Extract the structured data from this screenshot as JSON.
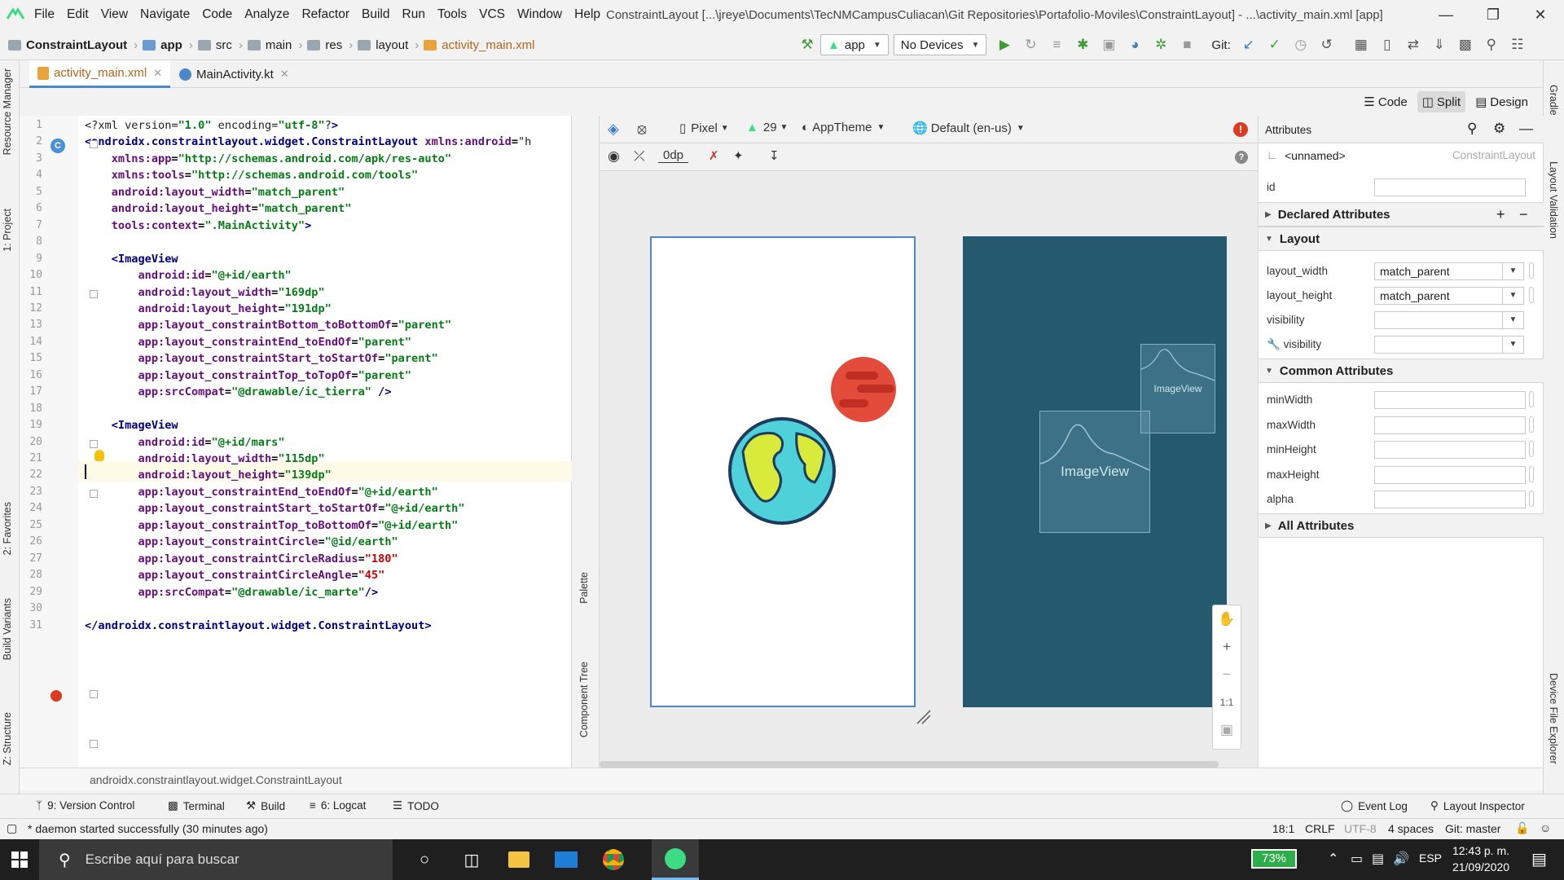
{
  "menubar": {
    "items": [
      "File",
      "Edit",
      "View",
      "Navigate",
      "Code",
      "Analyze",
      "Refactor",
      "Build",
      "Run",
      "Tools",
      "VCS",
      "Window",
      "Help"
    ],
    "title": "ConstraintLayout [...\\jreye\\Documents\\TecNMCampusCuliacan\\Git Repositories\\Portafolio-Moviles\\ConstraintLayout] - ...\\activity_main.xml [app]"
  },
  "breadcrumbs": [
    "ConstraintLayout",
    "app",
    "src",
    "main",
    "res",
    "layout",
    "activity_main.xml"
  ],
  "toolbar": {
    "run_config": "app",
    "device": "No Devices",
    "git_label": "Git:"
  },
  "tabs": [
    {
      "label": "activity_main.xml",
      "active": true
    },
    {
      "label": "MainActivity.kt",
      "active": false
    }
  ],
  "modes": {
    "code": "Code",
    "split": "Split",
    "design": "Design"
  },
  "code_lines": [
    "<?xml version=\"1.0\" encoding=\"utf-8\"?>",
    "<androidx.constraintlayout.widget.ConstraintLayout xmlns:android=\"h",
    "    xmlns:app=\"http://schemas.android.com/apk/res-auto\"",
    "    xmlns:tools=\"http://schemas.android.com/tools\"",
    "    android:layout_width=\"match_parent\"",
    "    android:layout_height=\"match_parent\"",
    "    tools:context=\".MainActivity\">",
    "",
    "    <ImageView",
    "        android:id=\"@+id/earth\"",
    "        android:layout_width=\"169dp\"",
    "        android:layout_height=\"191dp\"",
    "        app:layout_constraintBottom_toBottomOf=\"parent\"",
    "        app:layout_constraintEnd_toEndOf=\"parent\"",
    "        app:layout_constraintStart_toStartOf=\"parent\"",
    "        app:layout_constraintTop_toTopOf=\"parent\"",
    "        app:srcCompat=\"@drawable/ic_tierra\" />",
    "",
    "    <ImageView",
    "        android:id=\"@+id/mars\"",
    "        android:layout_width=\"115dp\"",
    "        android:layout_height=\"139dp\"",
    "        app:layout_constraintEnd_toEndOf=\"@+id/earth\"",
    "        app:layout_constraintStart_toStartOf=\"@+id/earth\"",
    "        app:layout_constraintTop_toBottomOf=\"@+id/earth\"",
    "        app:layout_constraintCircle=\"@id/earth\"",
    "        app:layout_constraintCircleRadius=\"180\"",
    "        app:layout_constraintCircleAngle=\"45\"",
    "        app:srcCompat=\"@drawable/ic_marte\"/>",
    "",
    "</androidx.constraintlayout.widget.ConstraintLayout>"
  ],
  "design_toolbar": {
    "device": "Pixel",
    "api": "29",
    "theme": "AppTheme",
    "locale": "Default (en-us)",
    "margin": "0dp"
  },
  "side_tabs": {
    "palette": "Palette",
    "component_tree": "Component Tree"
  },
  "blueprint": {
    "earth_label": "ImageView",
    "mars_label": "ImageView"
  },
  "zoom": {
    "fit": "1:1"
  },
  "attributes": {
    "title": "Attributes",
    "component_name": "<unnamed>",
    "component_type": "ConstraintLayout",
    "id_label": "id",
    "id_value": "",
    "declared_section": "Declared Attributes",
    "layout_section": "Layout",
    "layout_rows": [
      {
        "label": "layout_width",
        "value": "match_parent"
      },
      {
        "label": "layout_height",
        "value": "match_parent"
      },
      {
        "label": "visibility",
        "value": ""
      },
      {
        "label": "visibility",
        "value": ""
      }
    ],
    "common_section": "Common Attributes",
    "common_rows": [
      "minWidth",
      "maxWidth",
      "minHeight",
      "maxHeight",
      "alpha"
    ],
    "all_section": "All Attributes"
  },
  "left_stripe": [
    "Resource Manager",
    "1: Project",
    "2: Favorites",
    "Build Variants",
    "Z: Structure"
  ],
  "right_stripe": [
    "Gradle",
    "Layout Validation",
    "Device File Explorer"
  ],
  "breadline": "androidx.constraintlayout.widget.ConstraintLayout",
  "toolwindows": {
    "version_control": "9: Version Control",
    "terminal": "Terminal",
    "build": "Build",
    "logcat": "6: Logcat",
    "todo": "TODO",
    "event_log": "Event Log",
    "layout_inspector": "Layout Inspector"
  },
  "status": {
    "message": "* daemon started successfully (30 minutes ago)",
    "position": "18:1",
    "line_sep": "CRLF",
    "encoding": "UTF-8",
    "indent": "4 spaces",
    "git": "Git: master"
  },
  "taskbar": {
    "search_placeholder": "Escribe aquí para buscar",
    "battery": "73%",
    "lang": "ESP",
    "time": "12:43 p. m.",
    "date": "21/09/2020"
  },
  "colors": {
    "accent": "#4a88c7",
    "blueprint": "#25596e",
    "error": "#db3b21"
  }
}
